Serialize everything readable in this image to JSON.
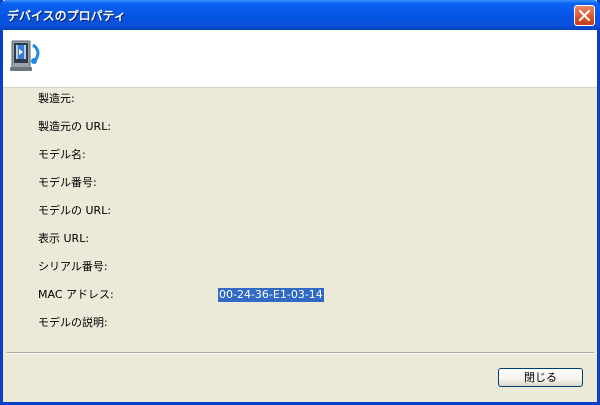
{
  "window": {
    "title": "デバイスのプロパティ"
  },
  "icons": {
    "close": "close-icon",
    "device": "media-device-icon"
  },
  "properties": [
    {
      "label": "製造元:",
      "value": ""
    },
    {
      "label": "製造元の URL:",
      "value": ""
    },
    {
      "label": "モデル名:",
      "value": ""
    },
    {
      "label": "モデル番号:",
      "value": ""
    },
    {
      "label": "モデルの URL:",
      "value": ""
    },
    {
      "label": "表示 URL:",
      "value": ""
    },
    {
      "label": "シリアル番号:",
      "value": ""
    },
    {
      "label": "MAC アドレス:",
      "value": "00-24-36-E1-03-14"
    },
    {
      "label": "モデルの説明:",
      "value": ""
    }
  ],
  "buttons": {
    "close_label": "閉じる"
  },
  "colors": {
    "title_bar": "#0a4fd8",
    "selection": "#316ac5",
    "dialog_bg": "#ece9d8"
  }
}
